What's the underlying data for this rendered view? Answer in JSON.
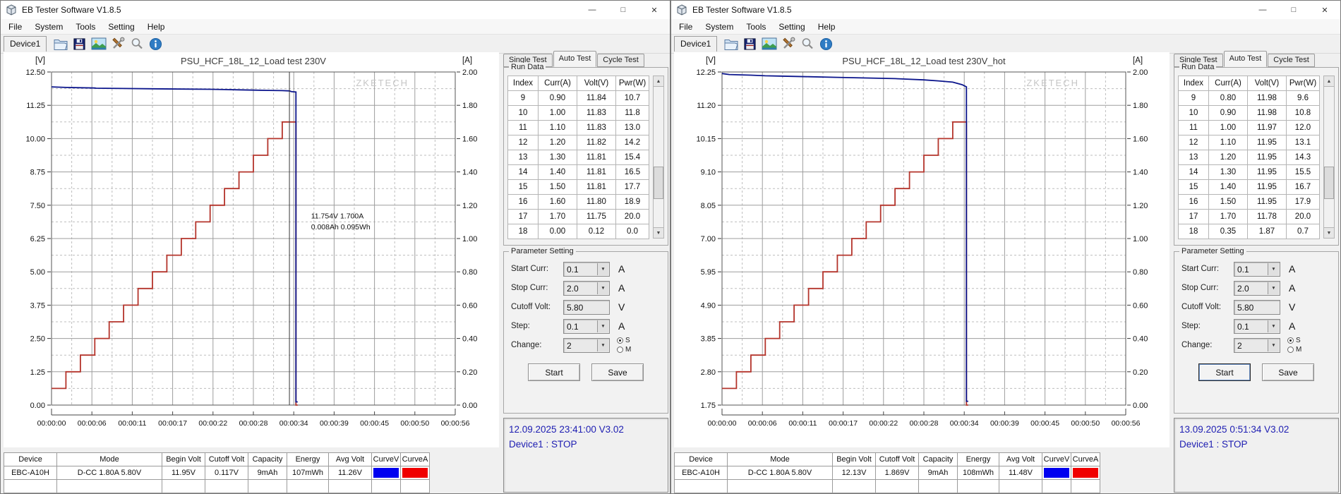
{
  "windows": [
    {
      "title": "EB Tester Software V1.8.5",
      "controls": {
        "minimize": "—",
        "maximize": "□",
        "close": "✕"
      },
      "menu": {
        "items": [
          "File",
          "System",
          "Tools",
          "Setting",
          "Help"
        ]
      },
      "toolbar": {
        "device_label": "Device1",
        "icons": [
          "open-file-icon",
          "save-icon",
          "image-export-icon",
          "tools-icon",
          "zoom-icon",
          "info-icon"
        ]
      },
      "side_panel": {
        "tabs": [
          {
            "label": "Single Test",
            "active": false
          },
          {
            "label": "Auto Test",
            "active": true
          },
          {
            "label": "Cycle Test",
            "active": false
          }
        ],
        "run_data": {
          "group_label": "Run Data",
          "headers": [
            "Index",
            "Curr(A)",
            "Volt(V)",
            "Pwr(W)"
          ],
          "rows": [
            [
              "9",
              "0.90",
              "11.84",
              "10.7"
            ],
            [
              "10",
              "1.00",
              "11.83",
              "11.8"
            ],
            [
              "11",
              "1.10",
              "11.83",
              "13.0"
            ],
            [
              "12",
              "1.20",
              "11.82",
              "14.2"
            ],
            [
              "13",
              "1.30",
              "11.81",
              "15.4"
            ],
            [
              "14",
              "1.40",
              "11.81",
              "16.5"
            ],
            [
              "15",
              "1.50",
              "11.81",
              "17.7"
            ],
            [
              "16",
              "1.60",
              "11.80",
              "18.9"
            ],
            [
              "17",
              "1.70",
              "11.75",
              "20.0"
            ],
            [
              "18",
              "0.00",
              "0.12",
              "0.0"
            ]
          ]
        },
        "parameter_setting": {
          "group_label": "Parameter Setting",
          "fields": [
            {
              "label": "Start Curr:",
              "value": "0.1",
              "unit": "A"
            },
            {
              "label": "Stop Curr:",
              "value": "2.0",
              "unit": "A"
            },
            {
              "label": "Cutoff Volt:",
              "value": "5.80",
              "unit": "V"
            },
            {
              "label": "Step:",
              "value": "0.1",
              "unit": "A"
            },
            {
              "label": "Change:",
              "value": "2",
              "unit": "",
              "radio": {
                "options": [
                  "S",
                  "M"
                ],
                "selected": "S"
              }
            }
          ],
          "buttons": [
            {
              "label": "Start",
              "focused": false
            },
            {
              "label": "Save",
              "focused": false
            }
          ]
        }
      },
      "status": {
        "line1": "12.09.2025 23:41:00  V3.02",
        "line2": "Device1 : STOP"
      },
      "bottom_table": {
        "headers": [
          "Device",
          "Mode",
          "Begin Volt",
          "Cutoff Volt",
          "Capacity",
          "Energy",
          "Avg Volt",
          "CurveV",
          "CurveA"
        ],
        "row": [
          "EBC-A10H",
          "D-CC 1.80A 5.80V",
          "11.95V",
          "0.117V",
          "9mAh",
          "107mWh",
          "11.26V"
        ],
        "curve_v_color": "#0000f0",
        "curve_a_color": "#f00000"
      },
      "chart": {
        "type": "line",
        "title": "PSU_HCF_18L_12_Load test 230V",
        "watermark": "ZKETECH",
        "v_axis": {
          "unit": "[V]",
          "min": 0.0,
          "max": 12.5,
          "ticks": [
            12.5,
            11.25,
            10.0,
            8.75,
            7.5,
            6.25,
            5.0,
            3.75,
            2.5,
            1.25,
            0.0
          ]
        },
        "a_axis": {
          "unit": "[A]",
          "min": 0.0,
          "max": 2.0,
          "ticks": [
            2.0,
            1.8,
            1.6,
            1.4,
            1.2,
            1.0,
            0.8,
            0.6,
            0.4,
            0.2,
            0.0
          ]
        },
        "x_axis": {
          "t_max": 56,
          "labels": [
            "00:00:00",
            "00:00:06",
            "00:00:11",
            "00:00:17",
            "00:00:22",
            "00:00:28",
            "00:00:34",
            "00:00:39",
            "00:00:45",
            "00:00:50",
            "00:00:56"
          ]
        },
        "series": {
          "voltage": {
            "name": "Voltage (V)",
            "color": "#0b158c",
            "points": [
              [
                0,
                11.94
              ],
              [
                2,
                11.92
              ],
              [
                4,
                11.91
              ],
              [
                6,
                11.9
              ],
              [
                6.2,
                11.89
              ],
              [
                10,
                11.88
              ],
              [
                14,
                11.87
              ],
              [
                18,
                11.86
              ],
              [
                22,
                11.85
              ],
              [
                24,
                11.84
              ],
              [
                26,
                11.83
              ],
              [
                28,
                11.82
              ],
              [
                30,
                11.81
              ],
              [
                32,
                11.8
              ],
              [
                33,
                11.79
              ],
              [
                33.3,
                11.76
              ],
              [
                33.9,
                11.75
              ],
              [
                33.9,
                0.12
              ],
              [
                34.15,
                0.12
              ]
            ]
          },
          "current": {
            "name": "Current (A)",
            "color": "#b4342b",
            "step_values": [
              0.1,
              0.2,
              0.3,
              0.4,
              0.5,
              0.6,
              0.7,
              0.8,
              0.9,
              1.0,
              1.1,
              1.2,
              1.3,
              1.4,
              1.5,
              1.6,
              1.7
            ],
            "step_seconds": 2,
            "end_t": 33.9,
            "drop_to": 0.0
          }
        },
        "cursor_t": 33.0,
        "annotation": {
          "t": 36.0,
          "v_positions": [
            7.0,
            6.6
          ],
          "lines": [
            "11.754V  1.700A",
            "0.008Ah 0.095Wh"
          ]
        }
      }
    },
    {
      "title": "EB Tester Software V1.8.5",
      "controls": {
        "minimize": "—",
        "maximize": "□",
        "close": "✕"
      },
      "menu": {
        "items": [
          "File",
          "System",
          "Tools",
          "Setting",
          "Help"
        ]
      },
      "toolbar": {
        "device_label": "Device1",
        "icons": [
          "open-file-icon",
          "save-icon",
          "image-export-icon",
          "tools-icon",
          "zoom-icon",
          "info-icon"
        ]
      },
      "side_panel": {
        "tabs": [
          {
            "label": "Single Test",
            "active": false
          },
          {
            "label": "Auto Test",
            "active": true
          },
          {
            "label": "Cycle Test",
            "active": false
          }
        ],
        "run_data": {
          "group_label": "Run Data",
          "headers": [
            "Index",
            "Curr(A)",
            "Volt(V)",
            "Pwr(W)"
          ],
          "rows": [
            [
              "9",
              "0.80",
              "11.98",
              "9.6"
            ],
            [
              "10",
              "0.90",
              "11.98",
              "10.8"
            ],
            [
              "11",
              "1.00",
              "11.97",
              "12.0"
            ],
            [
              "12",
              "1.10",
              "11.95",
              "13.1"
            ],
            [
              "13",
              "1.20",
              "11.95",
              "14.3"
            ],
            [
              "14",
              "1.30",
              "11.95",
              "15.5"
            ],
            [
              "15",
              "1.40",
              "11.95",
              "16.7"
            ],
            [
              "16",
              "1.50",
              "11.95",
              "17.9"
            ],
            [
              "17",
              "1.70",
              "11.78",
              "20.0"
            ],
            [
              "18",
              "0.35",
              "1.87",
              "0.7"
            ]
          ]
        },
        "parameter_setting": {
          "group_label": "Parameter Setting",
          "fields": [
            {
              "label": "Start Curr:",
              "value": "0.1",
              "unit": "A"
            },
            {
              "label": "Stop Curr:",
              "value": "2.0",
              "unit": "A"
            },
            {
              "label": "Cutoff Volt:",
              "value": "5.80",
              "unit": "V"
            },
            {
              "label": "Step:",
              "value": "0.1",
              "unit": "A"
            },
            {
              "label": "Change:",
              "value": "2",
              "unit": "",
              "radio": {
                "options": [
                  "S",
                  "M"
                ],
                "selected": "S"
              }
            }
          ],
          "buttons": [
            {
              "label": "Start",
              "focused": true
            },
            {
              "label": "Save",
              "focused": false
            }
          ]
        }
      },
      "status": {
        "line1": "13.09.2025 0:51:34  V3.02",
        "line2": "Device1 : STOP"
      },
      "bottom_table": {
        "headers": [
          "Device",
          "Mode",
          "Begin Volt",
          "Cutoff Volt",
          "Capacity",
          "Energy",
          "Avg Volt",
          "CurveV",
          "CurveA"
        ],
        "row": [
          "EBC-A10H",
          "D-CC 1.80A 5.80V",
          "12.13V",
          "1.869V",
          "9mAh",
          "108mWh",
          "11.48V"
        ],
        "curve_v_color": "#0000f0",
        "curve_a_color": "#f00000"
      },
      "chart": {
        "type": "line",
        "title": "PSU_HCF_18L_12_Load test 230V_hot",
        "watermark": "ZKETECH",
        "v_axis": {
          "unit": "[V]",
          "min": 1.75,
          "max": 12.25,
          "ticks": [
            12.25,
            11.2,
            10.15,
            9.1,
            8.05,
            7.0,
            5.95,
            4.9,
            3.85,
            2.8,
            1.75
          ]
        },
        "a_axis": {
          "unit": "[A]",
          "min": 0.0,
          "max": 2.0,
          "ticks": [
            2.0,
            1.8,
            1.6,
            1.4,
            1.2,
            1.0,
            0.8,
            0.6,
            0.4,
            0.2,
            0.0
          ]
        },
        "x_axis": {
          "t_max": 56,
          "labels": [
            "00:00:00",
            "00:00:06",
            "00:00:11",
            "00:00:17",
            "00:00:22",
            "00:00:28",
            "00:00:34",
            "00:00:39",
            "00:00:45",
            "00:00:50",
            "00:00:56"
          ]
        },
        "series": {
          "voltage": {
            "name": "Voltage (V)",
            "color": "#0b158c",
            "points": [
              [
                0,
                12.2
              ],
              [
                1,
                12.17
              ],
              [
                4,
                12.15
              ],
              [
                6,
                12.13
              ],
              [
                8,
                12.12
              ],
              [
                12,
                12.1
              ],
              [
                16,
                12.08
              ],
              [
                20,
                12.06
              ],
              [
                24,
                12.04
              ],
              [
                28,
                12.0
              ],
              [
                30,
                11.97
              ],
              [
                32,
                11.93
              ],
              [
                33.3,
                11.85
              ],
              [
                33.9,
                11.78
              ],
              [
                33.9,
                1.87
              ],
              [
                34.15,
                1.87
              ]
            ]
          },
          "current": {
            "name": "Current (A)",
            "color": "#b4342b",
            "step_values": [
              0.1,
              0.2,
              0.3,
              0.4,
              0.5,
              0.6,
              0.7,
              0.8,
              0.9,
              1.0,
              1.1,
              1.2,
              1.3,
              1.4,
              1.5,
              1.6,
              1.7
            ],
            "step_seconds": 2,
            "end_t": 33.9,
            "drop_to": 0.0
          }
        },
        "cursor_t": null,
        "annotation": null
      }
    }
  ]
}
